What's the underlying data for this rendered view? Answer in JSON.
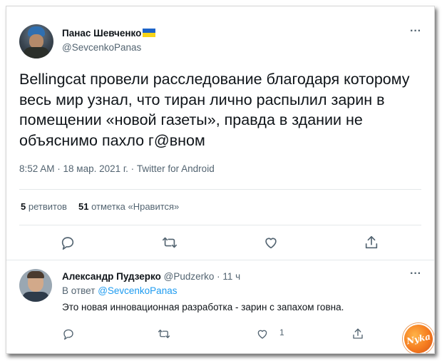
{
  "main_tweet": {
    "author_name": "Панас Шевченко",
    "author_handle": "@SevcenkoPanas",
    "text": "Bellingcat провели расследование благодаря которому весь мир узнал, что тиран лично распылил зарин в помещении «новой газеты», правда в здании не объяснимо пахло г@вном",
    "meta": "8:52 AM · 18 мар. 2021 г. · Twitter for Android",
    "retweets_count": "5",
    "retweets_label": "ретвитов",
    "likes_count": "51",
    "likes_label": "отметка «Нравится»"
  },
  "reply": {
    "author_name": "Александр Пудзерко",
    "author_handle": "@Pudzerko",
    "time": "· 11 ч",
    "reply_to_prefix": "В ответ",
    "reply_to_handle": "@SevcenkoPanas",
    "text": "Это новая инновационная разработка - зарин с запахом говна.",
    "like_count": "1"
  },
  "more_icon_glyph": "···",
  "watermark_text": "Nyka",
  "colors": {
    "text": "#0f1419",
    "secondary": "#536471",
    "link": "#1d9bf0",
    "flag_blue": "#1c63c9",
    "flag_yellow": "#f7d417"
  },
  "icons": [
    "reply-icon",
    "retweet-icon",
    "like-icon",
    "share-icon",
    "more-icon",
    "ukraine-flag-icon"
  ]
}
